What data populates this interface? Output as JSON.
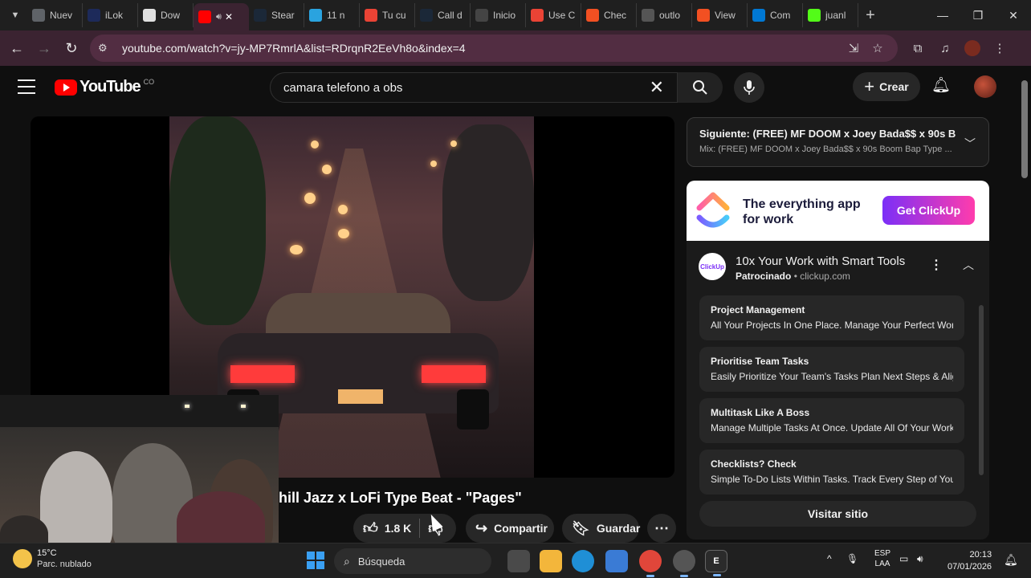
{
  "browser": {
    "tabs": [
      {
        "title": "Nuev",
        "icon": "chrome-icon",
        "color": "#5f6368"
      },
      {
        "title": "iLok",
        "icon": "ilok-icon",
        "color": "#1d2a5a"
      },
      {
        "title": "Dow",
        "icon": "chrome-icon",
        "color": "#e0e0e0"
      },
      {
        "title": "",
        "icon": "youtube-icon",
        "color": "#ff0000",
        "active": true
      },
      {
        "title": "Stear",
        "icon": "steam-icon",
        "color": "#1b2838"
      },
      {
        "title": "11 n",
        "icon": "telegram-icon",
        "color": "#2aa3df"
      },
      {
        "title": "Tu cu",
        "icon": "gmail-icon",
        "color": "#ea4335"
      },
      {
        "title": "Call d",
        "icon": "steam-icon",
        "color": "#1b2838"
      },
      {
        "title": "Inicio",
        "icon": "document-icon",
        "color": "#444"
      },
      {
        "title": "Use C",
        "icon": "gmail-icon",
        "color": "#ea4335"
      },
      {
        "title": "Chec",
        "icon": "microsoft-icon",
        "color": "#f25022"
      },
      {
        "title": "outlo",
        "icon": "globe-icon",
        "color": "#555"
      },
      {
        "title": "View",
        "icon": "microsoft-icon",
        "color": "#f25022"
      },
      {
        "title": "Com",
        "icon": "azure-icon",
        "color": "#0078d4"
      },
      {
        "title": "juanl",
        "icon": "kick-icon",
        "color": "#53fc18"
      }
    ],
    "url": "youtube.com/watch?v=jy-MP7RmrlA&list=RDrqnR2EeVh8o&index=4"
  },
  "youtube": {
    "logo_text": "YouTube",
    "country": "CO",
    "search_query": "camara telefono a obs",
    "create_label": "Crear",
    "video_title": "hill Jazz x LoFi Type Beat - \"Pages\"",
    "likes": "1.8 K",
    "share_label": "Compartir",
    "save_label": "Guardar"
  },
  "sidebar": {
    "next_up": "Siguiente: (FREE) MF DOOM x Joey Bada$$ x 90s B...",
    "next_mix": "Mix: (FREE) MF DOOM x Joey Bada$$ x 90s Boom Bap Type ...",
    "ad": {
      "banner_tagline_1": "The everything app",
      "banner_tagline_2": "for work",
      "banner_cta": "Get ClickUp",
      "icon_text": "ClickUp",
      "title": "10x Your Work with Smart Tools",
      "sponsored": "Patrocinado",
      "domain": "• clickup.com",
      "features": [
        {
          "heading": "Project Management",
          "desc": "All Your Projects In One Place. Manage Your Perfect Work..."
        },
        {
          "heading": "Prioritise Team Tasks",
          "desc": "Easily Prioritize Your Team's Tasks Plan Next Steps & Align..."
        },
        {
          "heading": "Multitask Like A Boss",
          "desc": "Manage Multiple Tasks At Once. Update All Of Your Work I..."
        },
        {
          "heading": "Checklists? Check",
          "desc": "Simple To-Do Lists Within Tasks. Track Every Step of Your ..."
        }
      ],
      "visit_label": "Visitar sitio"
    }
  },
  "taskbar": {
    "temperature": "15°C",
    "weather": "Parc. nublado",
    "search_placeholder": "Búsqueda",
    "lang_1": "ESP",
    "lang_2": "LAA",
    "time": "20:13",
    "date": "07/01/2026"
  }
}
